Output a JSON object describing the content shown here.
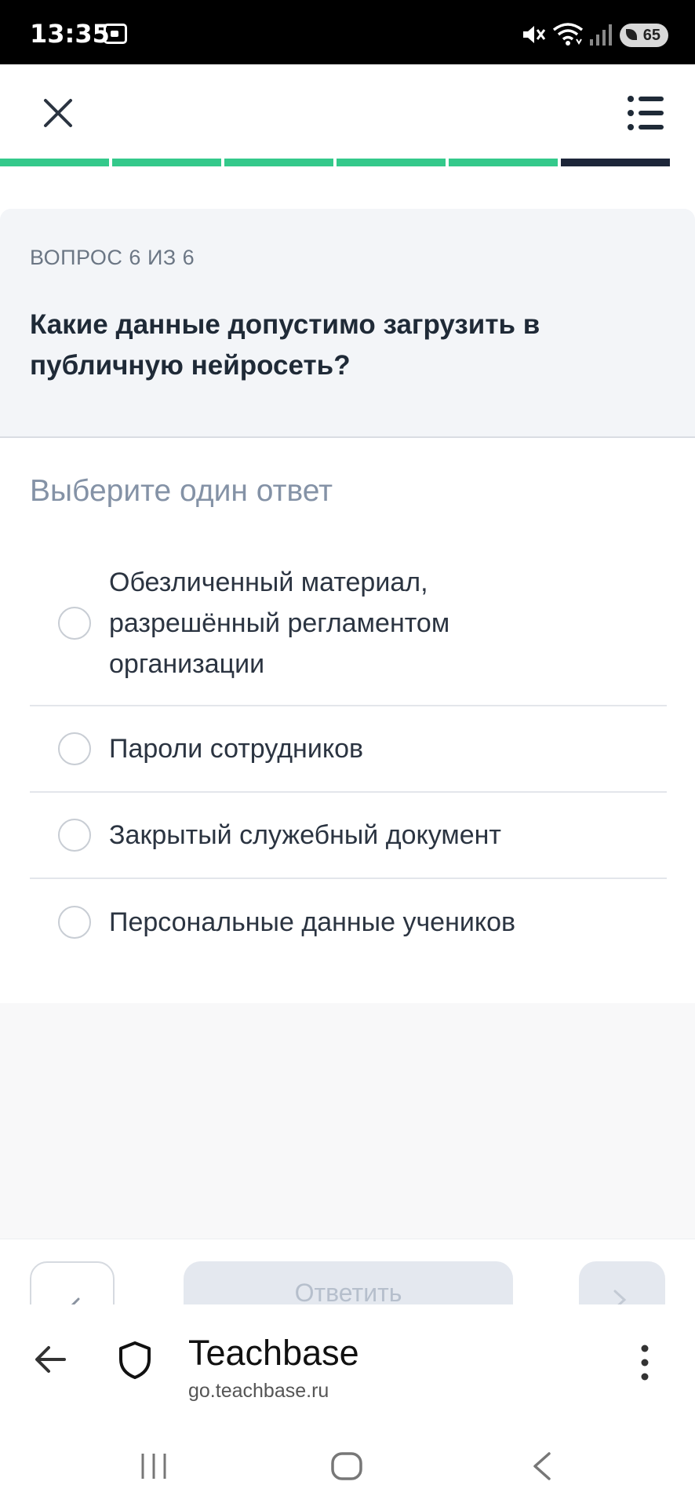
{
  "status_bar": {
    "time": "13:35",
    "battery": "65",
    "icons": [
      "screenshot-icon",
      "mute-icon",
      "wifi-icon",
      "signal-icon",
      "battery-icon"
    ]
  },
  "header": {
    "icons": [
      "close-icon",
      "list-menu-icon"
    ]
  },
  "progress": {
    "total": 6,
    "current": 6,
    "colors": {
      "done": "#34c98b",
      "current": "#1d2639"
    }
  },
  "question": {
    "number_label": "ВОПРОС 6 ИЗ 6",
    "text": "Какие данные допустимо загрузить в публичную нейросеть?"
  },
  "instruction": "Выберите один ответ",
  "options": [
    {
      "label": "Обезличенный материал, разрешённый регламентом организации",
      "selected": false
    },
    {
      "label": "Пароли сотрудников",
      "selected": false
    },
    {
      "label": "Закрытый служебный документ",
      "selected": false
    },
    {
      "label": "Персональные данные учеников",
      "selected": false
    }
  ],
  "actions": {
    "answer_label": "Ответить",
    "icons": [
      "pencil-icon",
      "chevron-right-icon"
    ]
  },
  "browser": {
    "site_title": "Teachbase",
    "site_url": "go.teachbase.ru",
    "icons": [
      "back-arrow-icon",
      "shield-icon",
      "more-vertical-icon"
    ]
  },
  "navbar": {
    "icons": [
      "recent-apps-icon",
      "home-icon",
      "back-icon"
    ]
  }
}
